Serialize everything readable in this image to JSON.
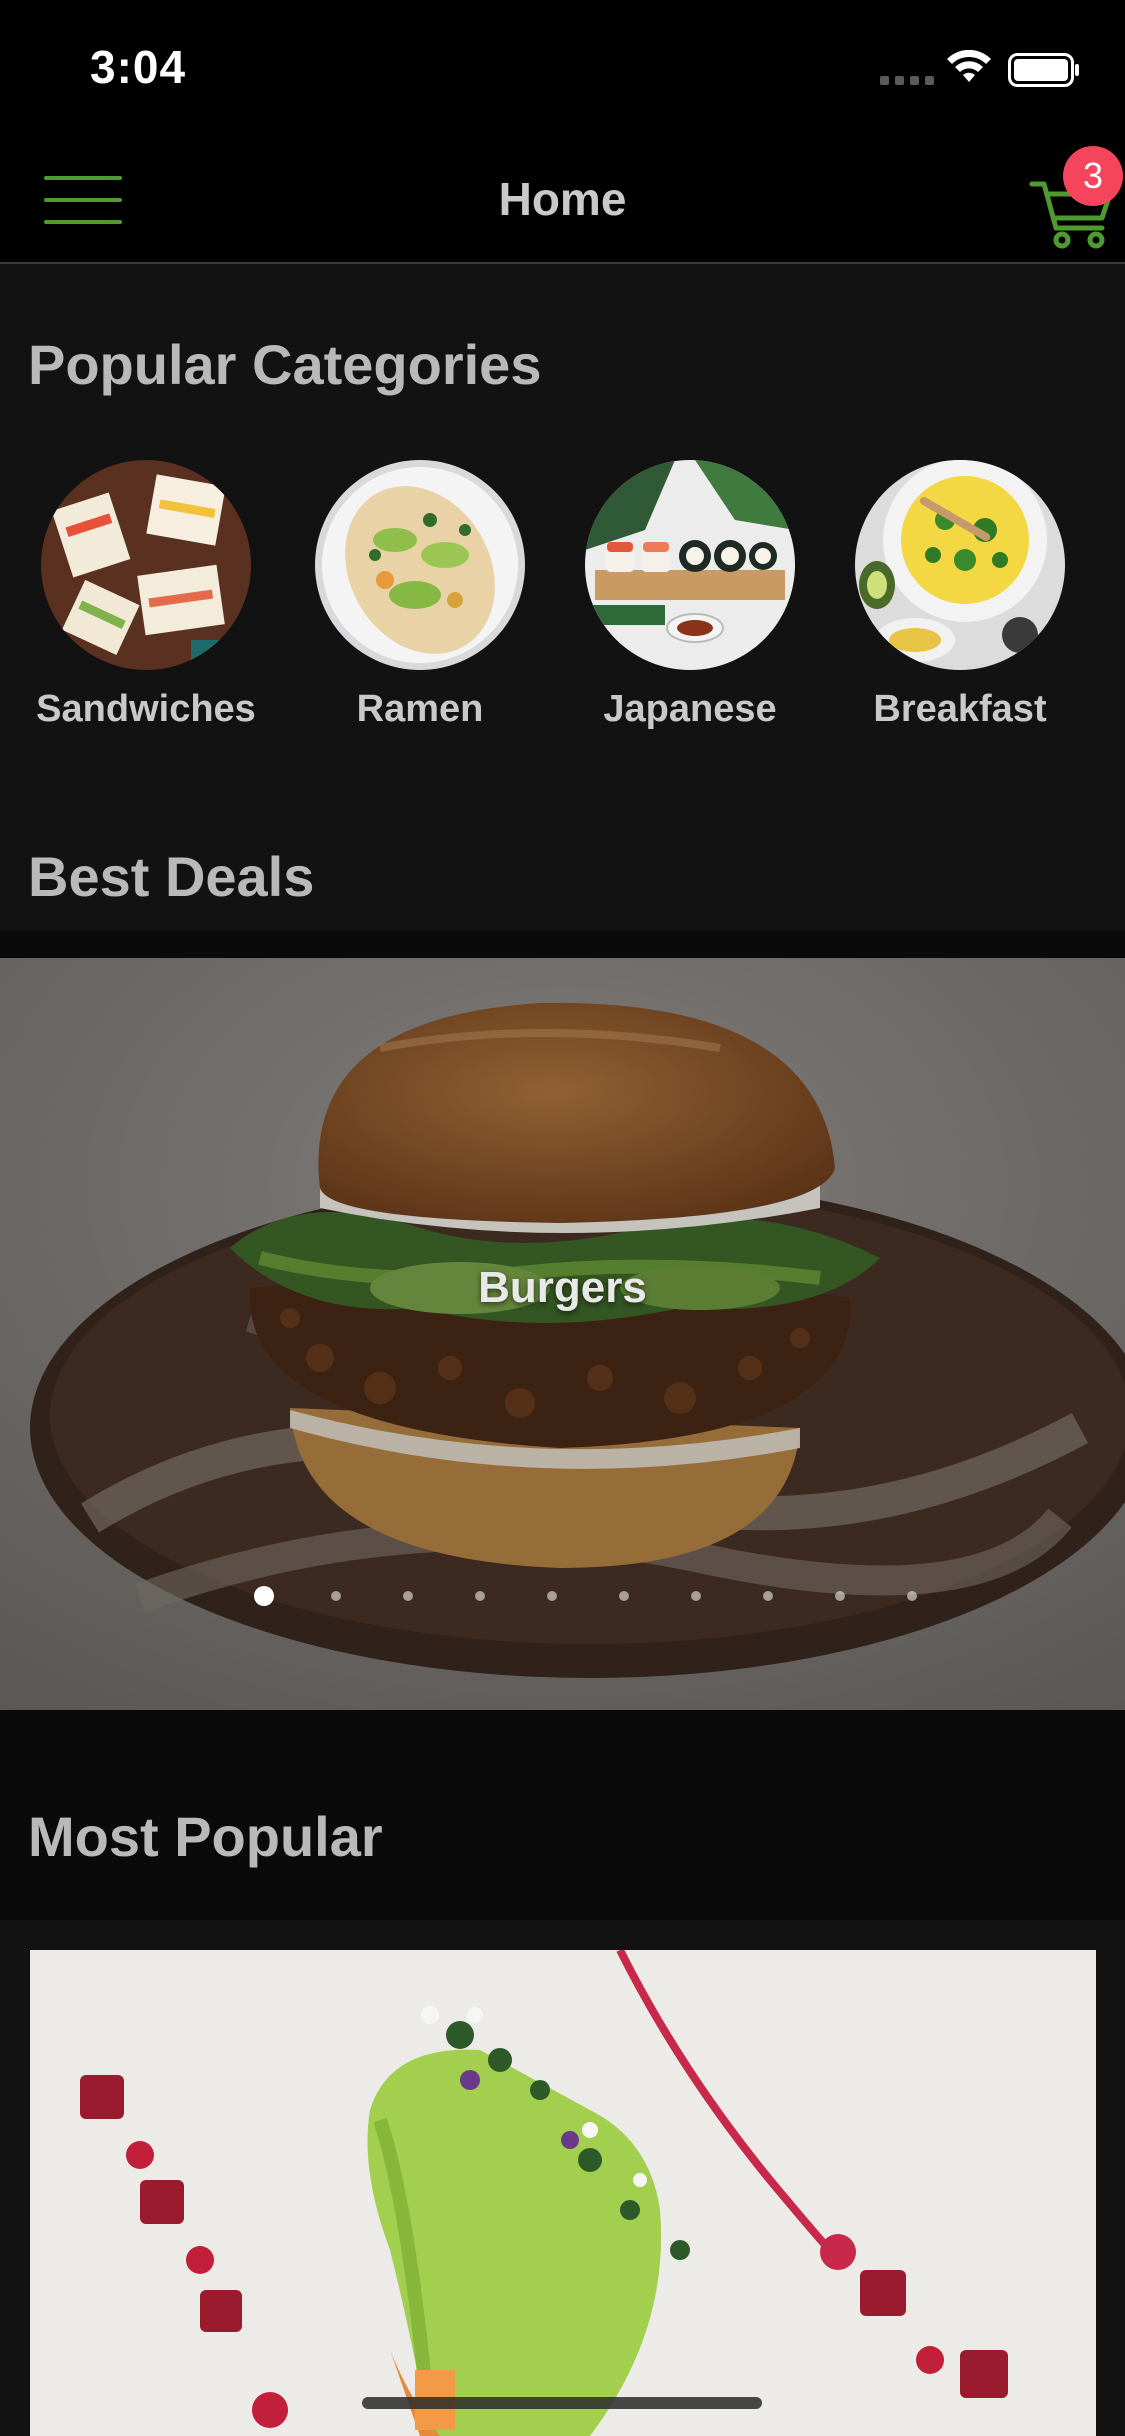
{
  "status_bar": {
    "time": "3:04"
  },
  "nav": {
    "title": "Home",
    "cart_count": "3"
  },
  "sections": {
    "popular_categories": "Popular Categories",
    "best_deals": "Best Deals",
    "most_popular": "Most Popular"
  },
  "categories": [
    {
      "label": "Sandwiches",
      "icon": "sandwiches-image"
    },
    {
      "label": "Ramen",
      "icon": "ramen-image"
    },
    {
      "label": "Japanese",
      "icon": "japanese-image"
    },
    {
      "label": "Breakfast",
      "icon": "breakfast-image"
    }
  ],
  "best_deals": {
    "current_label": "Burgers",
    "page_count": 10,
    "active_page": 1
  },
  "colors": {
    "accent": "#4e9a2e",
    "badge": "#f5455c",
    "background": "#121212"
  }
}
